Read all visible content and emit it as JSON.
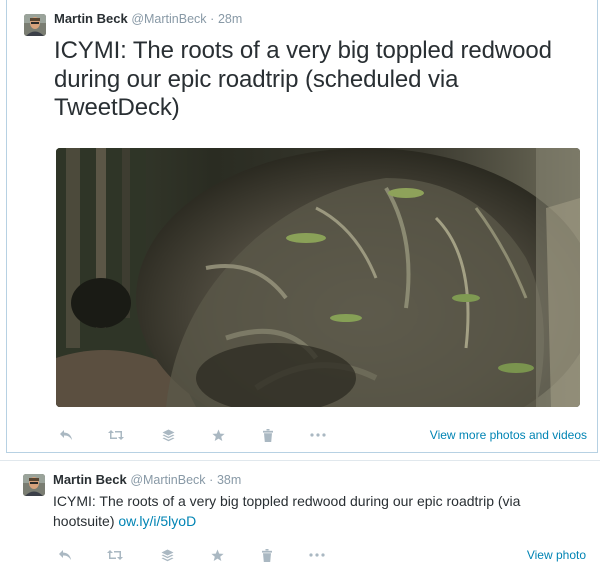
{
  "tweets": [
    {
      "author_name": "Martin Beck",
      "handle": "@MartinBeck",
      "separator": "·",
      "time": "28m",
      "text": "ICYMI: The roots of a very big toppled redwood during our epic roadtrip (scheduled via TweetDeck)",
      "media_icon": "photo-redwood-roots",
      "action_link": "View more photos and videos"
    },
    {
      "author_name": "Martin Beck",
      "handle": "@MartinBeck",
      "separator": "·",
      "time": "38m",
      "text": "ICYMI: The roots of a very big toppled redwood during our epic roadtrip (via hootsuite) ",
      "link_text": "ow.ly/i/5lyoD",
      "action_link": "View photo"
    }
  ],
  "actions": [
    "reply-icon",
    "retweet-icon",
    "buffer-icon",
    "favorite-icon",
    "delete-icon",
    "more-icon"
  ],
  "colors": {
    "text": "#292f33",
    "muted": "#8899a6",
    "link": "#0084b4",
    "icon": "#aab8c2",
    "border_selected": "#b7d1e3",
    "divider": "#e1e8ed"
  }
}
